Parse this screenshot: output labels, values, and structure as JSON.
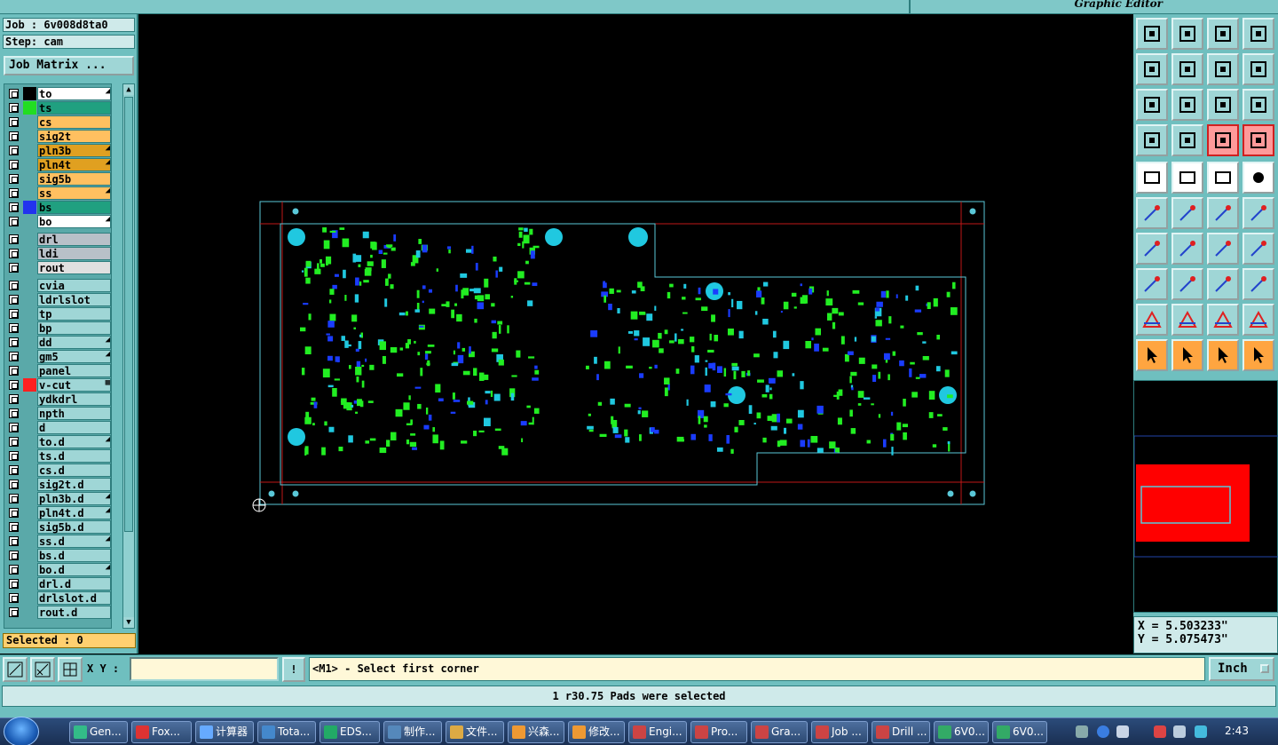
{
  "window": {
    "title": "Graphic Editor"
  },
  "job": {
    "job_label": "Job : 6v008d8ta0",
    "step_label": "Step: cam",
    "matrix_button": "Job Matrix ..."
  },
  "layers": [
    {
      "name": "to",
      "color": "#000000",
      "bg": "#ffffff",
      "mark": "◢"
    },
    {
      "name": "ts",
      "color": "#22dd22",
      "bg": "#20a080",
      "mark": ""
    },
    {
      "name": "cs",
      "color": "",
      "bg": "#ffc060",
      "mark": ""
    },
    {
      "name": "sig2t",
      "color": "",
      "bg": "#ffc060",
      "mark": ""
    },
    {
      "name": "pln3b",
      "color": "",
      "bg": "#e0a020",
      "mark": "◢"
    },
    {
      "name": "pln4t",
      "color": "",
      "bg": "#e0a020",
      "mark": "◢"
    },
    {
      "name": "sig5b",
      "color": "",
      "bg": "#ffc060",
      "mark": ""
    },
    {
      "name": "ss",
      "color": "",
      "bg": "#ffc060",
      "mark": "◢"
    },
    {
      "name": "bs",
      "color": "#2233ee",
      "bg": "#20a080",
      "mark": ""
    },
    {
      "name": "bo",
      "color": "",
      "bg": "#ffffff",
      "mark": "◢"
    },
    {
      "name": "drl",
      "color": "",
      "bg": "#b8c0c8",
      "mark": ""
    },
    {
      "name": "ldi",
      "color": "",
      "bg": "#b8c0c8",
      "mark": ""
    },
    {
      "name": "rout",
      "color": "",
      "bg": "#e0e0e0",
      "mark": ""
    },
    {
      "name": "cvia",
      "color": "",
      "bg": "#9fd6d6",
      "mark": ""
    },
    {
      "name": "ldrlslot",
      "color": "",
      "bg": "#9fd6d6",
      "mark": ""
    },
    {
      "name": "tp",
      "color": "",
      "bg": "#9fd6d6",
      "mark": ""
    },
    {
      "name": "bp",
      "color": "",
      "bg": "#9fd6d6",
      "mark": ""
    },
    {
      "name": "dd",
      "color": "",
      "bg": "#9fd6d6",
      "mark": "◢"
    },
    {
      "name": "gm5",
      "color": "",
      "bg": "#9fd6d6",
      "mark": "◢"
    },
    {
      "name": "panel",
      "color": "",
      "bg": "#9fd6d6",
      "mark": ""
    },
    {
      "name": "v-cut",
      "color": "#ff2020",
      "bg": "#9fd6d6",
      "mark": "▦"
    },
    {
      "name": "ydkdrl",
      "color": "",
      "bg": "#9fd6d6",
      "mark": ""
    },
    {
      "name": "npth",
      "color": "",
      "bg": "#9fd6d6",
      "mark": ""
    },
    {
      "name": "d",
      "color": "",
      "bg": "#9fd6d6",
      "mark": ""
    },
    {
      "name": "to.d",
      "color": "",
      "bg": "#9fd6d6",
      "mark": "◢"
    },
    {
      "name": "ts.d",
      "color": "",
      "bg": "#9fd6d6",
      "mark": ""
    },
    {
      "name": "cs.d",
      "color": "",
      "bg": "#9fd6d6",
      "mark": ""
    },
    {
      "name": "sig2t.d",
      "color": "",
      "bg": "#9fd6d6",
      "mark": ""
    },
    {
      "name": "pln3b.d",
      "color": "",
      "bg": "#9fd6d6",
      "mark": "◢"
    },
    {
      "name": "pln4t.d",
      "color": "",
      "bg": "#9fd6d6",
      "mark": "◢"
    },
    {
      "name": "sig5b.d",
      "color": "",
      "bg": "#9fd6d6",
      "mark": ""
    },
    {
      "name": "ss.d",
      "color": "",
      "bg": "#9fd6d6",
      "mark": "◢"
    },
    {
      "name": "bs.d",
      "color": "",
      "bg": "#9fd6d6",
      "mark": ""
    },
    {
      "name": "bo.d",
      "color": "",
      "bg": "#9fd6d6",
      "mark": "◢"
    },
    {
      "name": "drl.d",
      "color": "",
      "bg": "#9fd6d6",
      "mark": ""
    },
    {
      "name": "drlslot.d",
      "color": "",
      "bg": "#9fd6d6",
      "mark": ""
    },
    {
      "name": "rout.d",
      "color": "",
      "bg": "#9fd6d6",
      "mark": ""
    }
  ],
  "selected": "Selected : 0",
  "coords": {
    "x": "X = 5.503233\"",
    "y": "Y = 5.075473\""
  },
  "command": {
    "xy_label": "X Y :",
    "xy_value": "",
    "prompt": "<M1> - Select first corner",
    "unit": "Inch"
  },
  "status": "1 r30.75 Pads were selected",
  "taskbar": {
    "tasks": [
      "Gen...",
      "Fox...",
      "计算器",
      "Tota...",
      "EDS...",
      "制作...",
      "文件...",
      "兴森...",
      "修改...",
      "Engi...",
      "Pro...",
      "Gra...",
      "Job ...",
      "Drill ...",
      "6V0...",
      "6V0..."
    ],
    "clock": "2:43"
  },
  "icons": {
    "tool_rows": [
      [
        "import-icon",
        "export-icon",
        "home-icon",
        "window-split-icon"
      ],
      [
        "zoom-left-icon",
        "zoom-right-icon",
        "undo-icon",
        "redo-icon"
      ],
      [
        "fit-icon",
        "center-icon",
        "zoom-1-2-icon",
        "help-icon"
      ],
      [
        "settings-icon",
        "key-icon",
        "snap-icon",
        "snap-alt-icon"
      ],
      [
        "pad-icon",
        "outline-icon",
        "ruler-icon",
        "dot-icon"
      ],
      [
        "net-icon",
        "cross-icon",
        "connect-icon",
        "link-icon"
      ],
      [
        "angle-icon",
        "line-icon",
        "arc-icon",
        "text-icon"
      ],
      [
        "move-icon",
        "minus-icon",
        "measure-icon",
        "copy-icon"
      ],
      [
        "triangle-icon",
        "triangle-a-icon",
        "triangle-b-icon",
        "triangle-c-icon"
      ],
      [
        "pointer-icon",
        "pointer-select-icon",
        "pointer-edit-icon",
        "route-icon"
      ]
    ]
  }
}
